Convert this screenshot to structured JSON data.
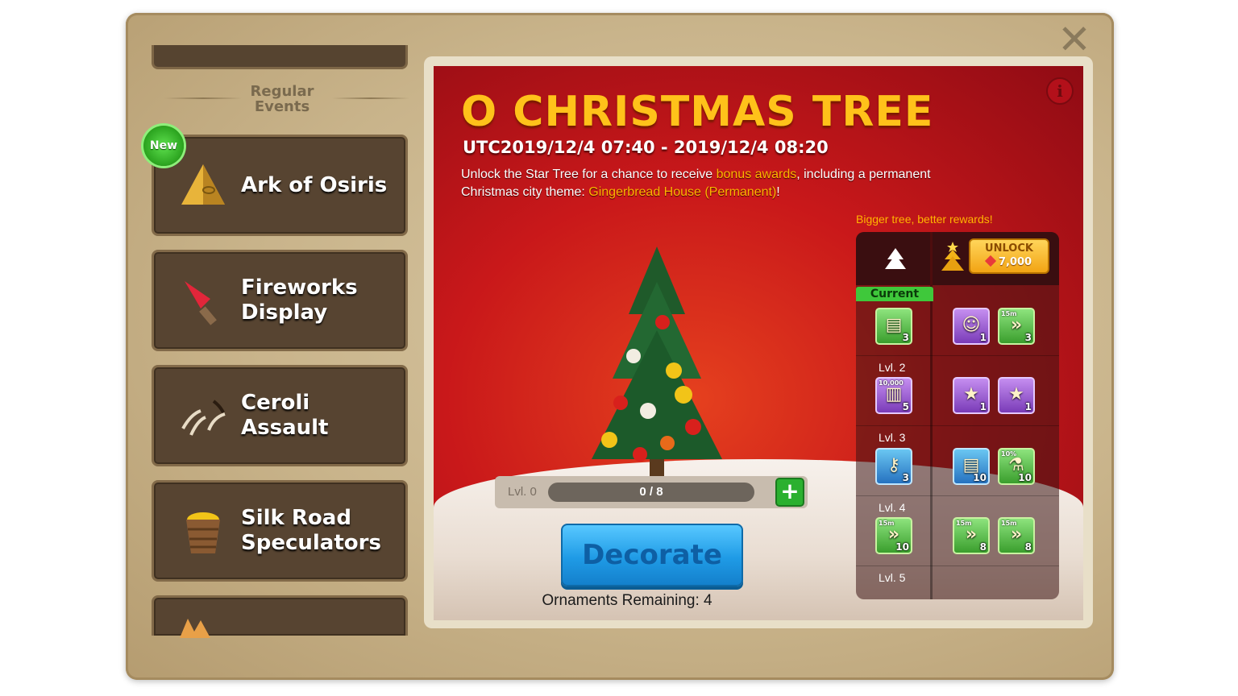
{
  "sidebar": {
    "heading": "Regular\nEvents",
    "new_badge": "New",
    "events": [
      {
        "label": "Ark of Osiris",
        "icon": "pyramid-icon"
      },
      {
        "label": "Fireworks\nDisplay",
        "icon": "firework-rocket-icon"
      },
      {
        "label": "Ceroli Assault",
        "icon": "claw-marks-icon"
      },
      {
        "label": "Silk Road\nSpeculators",
        "icon": "gold-basket-icon"
      },
      {
        "label": "",
        "icon": "fox-icon"
      }
    ]
  },
  "close_icon": "close-icon",
  "event": {
    "title": "O CHRISTMAS TREE",
    "time": "UTC2019/12/4 07:40 - 2019/12/4 08:20",
    "desc_part1": "Unlock the Star Tree for a chance to receive ",
    "desc_hl1": "bonus awards",
    "desc_part2": ", including a permanent Christmas city theme: ",
    "desc_hl2": "Gingerbread House (Permanent)",
    "desc_part3": "!",
    "info_icon": "i"
  },
  "progress": {
    "level_label": "Lvl. 0",
    "text": "0 / 8",
    "fraction": 0,
    "plus": "+"
  },
  "decorate_button": "Decorate",
  "ornaments_remaining": "Ornaments Remaining: 4",
  "rewards": {
    "note": "Bigger tree, better rewards!",
    "unlock_label": "UNLOCK",
    "unlock_cost": "7,000",
    "current_label": "Current",
    "levels": [
      {
        "label": "",
        "base": [
          {
            "count": "3",
            "tag": "",
            "color": "g",
            "icon": "resource-chest-icon"
          }
        ],
        "star": [
          {
            "count": "1",
            "tag": "",
            "color": "p",
            "icon": "commander-head-icon"
          },
          {
            "count": "3",
            "tag": "15m",
            "color": "g",
            "icon": "speedup-icon"
          }
        ]
      },
      {
        "label": "Lvl. 2",
        "base": [
          {
            "count": "5",
            "tag": "10,000",
            "color": "p",
            "icon": "gem-book-icon"
          }
        ],
        "star": [
          {
            "count": "1",
            "tag": "",
            "color": "p",
            "icon": "silver-star-icon"
          },
          {
            "count": "1",
            "tag": "",
            "color": "p",
            "icon": "silver-star-icon"
          }
        ]
      },
      {
        "label": "Lvl. 3",
        "base": [
          {
            "count": "3",
            "tag": "",
            "color": "b",
            "icon": "silver-key-icon"
          }
        ],
        "star": [
          {
            "count": "10",
            "tag": "",
            "color": "b",
            "icon": "resource-chest-icon"
          },
          {
            "count": "10",
            "tag": "10%",
            "color": "g",
            "icon": "potion-icon"
          }
        ]
      },
      {
        "label": "Lvl. 4",
        "base": [
          {
            "count": "10",
            "tag": "15m",
            "color": "g",
            "icon": "speedup-icon"
          }
        ],
        "star": [
          {
            "count": "8",
            "tag": "15m",
            "color": "g",
            "icon": "speedup-icon"
          },
          {
            "count": "8",
            "tag": "15m",
            "color": "g",
            "icon": "speedup-icon"
          }
        ]
      },
      {
        "label": "Lvl. 5",
        "base": [],
        "star": []
      }
    ]
  },
  "colors": {
    "title": "#ffc21a",
    "highlight": "#ffb400",
    "decorate": "#1f9be6",
    "panel_red": "#c9181a",
    "parchment": "#c9b48b"
  }
}
